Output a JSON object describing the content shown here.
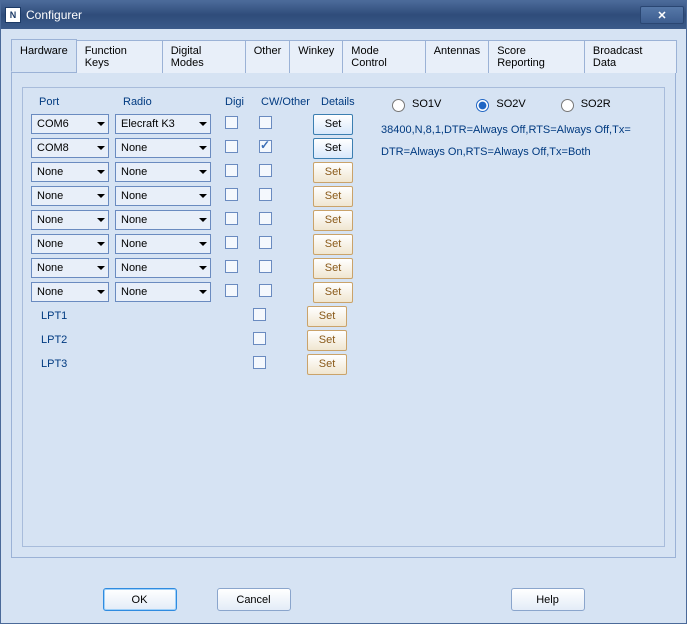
{
  "window": {
    "title": "Configurer"
  },
  "tabs": [
    {
      "label": "Hardware"
    },
    {
      "label": "Function Keys"
    },
    {
      "label": "Digital Modes"
    },
    {
      "label": "Other"
    },
    {
      "label": "Winkey"
    },
    {
      "label": "Mode Control"
    },
    {
      "label": "Antennas"
    },
    {
      "label": "Score Reporting"
    },
    {
      "label": "Broadcast Data"
    }
  ],
  "activeTab": 0,
  "headers": {
    "port": "Port",
    "radio": "Radio",
    "digi": "Digi",
    "cw": "CW/Other",
    "details": "Details"
  },
  "setLabel": "Set",
  "rows": [
    {
      "port": "COM6",
      "radio": "Elecraft K3",
      "hasDigi": true,
      "digi": false,
      "cw": false,
      "setStyle": "highlight",
      "detail": "38400,N,8,1,DTR=Always Off,RTS=Always Off,Tx="
    },
    {
      "port": "COM8",
      "radio": "None",
      "hasDigi": true,
      "digi": false,
      "cw": true,
      "setStyle": "highlight",
      "detail": "DTR=Always On,RTS=Always Off,Tx=Both"
    },
    {
      "port": "None",
      "radio": "None",
      "hasDigi": true,
      "digi": false,
      "cw": false,
      "setStyle": "",
      "detail": ""
    },
    {
      "port": "None",
      "radio": "None",
      "hasDigi": true,
      "digi": false,
      "cw": false,
      "setStyle": "",
      "detail": ""
    },
    {
      "port": "None",
      "radio": "None",
      "hasDigi": true,
      "digi": false,
      "cw": false,
      "setStyle": "",
      "detail": ""
    },
    {
      "port": "None",
      "radio": "None",
      "hasDigi": true,
      "digi": false,
      "cw": false,
      "setStyle": "",
      "detail": ""
    },
    {
      "port": "None",
      "radio": "None",
      "hasDigi": true,
      "digi": false,
      "cw": false,
      "setStyle": "",
      "detail": ""
    },
    {
      "port": "None",
      "radio": "None",
      "hasDigi": true,
      "digi": false,
      "cw": false,
      "setStyle": "",
      "detail": ""
    }
  ],
  "lptRows": [
    {
      "label": "LPT1",
      "cw": false
    },
    {
      "label": "LPT2",
      "cw": false
    },
    {
      "label": "LPT3",
      "cw": false
    }
  ],
  "soModes": {
    "so1v": "SO1V",
    "so2v": "SO2V",
    "so2r": "SO2R",
    "selected": "so2v"
  },
  "buttons": {
    "ok": "OK",
    "cancel": "Cancel",
    "help": "Help"
  }
}
